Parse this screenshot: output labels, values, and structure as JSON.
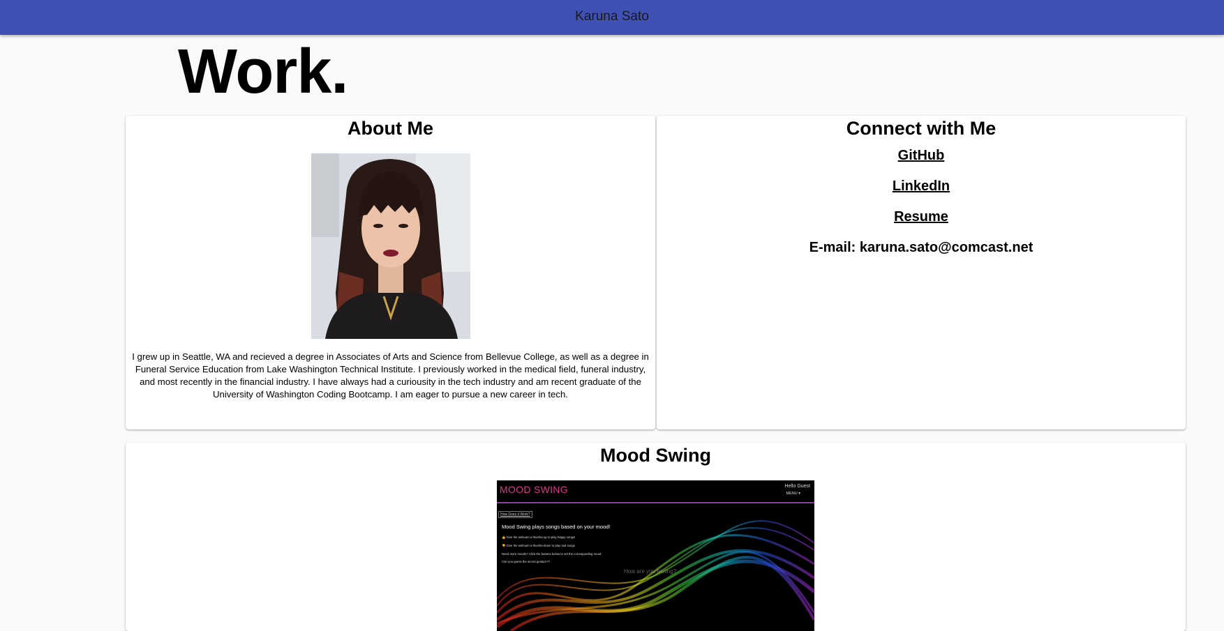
{
  "app": {
    "title": "Karuna Sato"
  },
  "page": {
    "heading": "Work."
  },
  "about": {
    "title": "About Me",
    "photo_icon": "portrait-photo",
    "bio": "I grew up in Seattle, WA and recieved a degree in Associates of Arts and Science from Bellevue College, as well as a degree in Funeral Service Education from Lake Washington Technical Institute. I previously worked in the medical field, funeral industry, and most recently in the financial industry. I have always had a curiousity in the tech industry and am recent graduate of the University of Washington Coding Bootcamp. I am eager to pursue a new career in tech."
  },
  "connect": {
    "title": "Connect with Me",
    "links": [
      {
        "label": "GitHub"
      },
      {
        "label": "LinkedIn"
      },
      {
        "label": "Resume"
      }
    ],
    "email": "E-mail: karuna.sato@comcast.net"
  },
  "project": {
    "title": "Mood Swing",
    "screenshot": {
      "logo": "MOOD SWING",
      "greeting": "Hello Guest",
      "menu": "MENU ▾",
      "how_link": "How Does it Work?",
      "panel_title": "Mood Swing plays songs based on your mood!",
      "panel_lines": [
        "👍 Give the webcam a thumbs-up to play happy songs!",
        "👎 Give the webcam a thumbs-down to play sad songs",
        "Need more moods? Click the buttons below to set the corresponding mood",
        "Can you guess the secret gesture??"
      ],
      "faint_text": "How are you feeling?"
    }
  },
  "colors": {
    "appbar": "#3f51b5",
    "background": "#fafafa",
    "card": "#ffffff",
    "mood_swing_logo": "#d83a8a"
  }
}
